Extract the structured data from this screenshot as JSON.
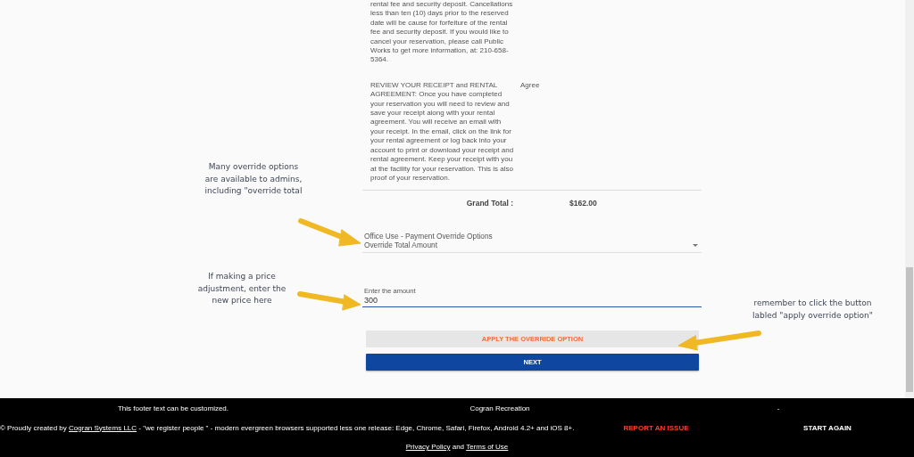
{
  "terms": [
    {
      "text": "rental fee and security deposit. Cancellations less than ten (10) days prior to the reserved date will be cause for forfeiture of the rental fee and security deposit. If you would like to cancel your reservation, please call Public Works to get more information, at: 210-658-5364."
    },
    {
      "text": "REVIEW YOUR RECEIPT and RENTAL AGREEMENT: Once you have completed your reservation you will need to review and save your receipt along with your rental agreement. You will receive an email with your receipt. In the email, click on the link for your rental agreement or log back into your account to print or download your receipt and rental agreement. Keep your receipt with you at the facility for your reservation. This is also proof of your reservation.",
      "response": "Agree"
    }
  ],
  "grand_total": {
    "label": "Grand Total :",
    "value": "$162.00"
  },
  "override_select": {
    "label": "Office Use - Payment Override Options",
    "value": "Override Total Amount"
  },
  "amount_field": {
    "label": "Enter the amount",
    "value": "300"
  },
  "buttons": [
    {
      "label": "APPLY THE OVERRIDE OPTION",
      "kind": "secondary"
    },
    {
      "label": "NEXT",
      "kind": "primary"
    }
  ],
  "annotations": [
    {
      "text": "Many override options are available to admins, including \"override total"
    },
    {
      "text": "If making a price adjustment, enter the new price here"
    },
    {
      "text": "remember to click the button labled \"apply override option\""
    }
  ],
  "footer": {
    "custom_text": "This footer text can be customized.",
    "org": "Cogran Recreation",
    "extra": "-",
    "credit_prefix": "© Proudly created by ",
    "credit_link": "Cogran Systems LLC",
    "credit_suffix": " - \"we register people \" - modern evergreen browsers supported less one release: Edge, Chrome, Safari, Firefox, Android 4.2+ and iOS 8+.",
    "report_link": "REPORT AN ISSUE",
    "start_again": "START AGAIN",
    "privacy_link": "Privacy Policy",
    "and": " and ",
    "terms_link": "Terms of Use"
  }
}
